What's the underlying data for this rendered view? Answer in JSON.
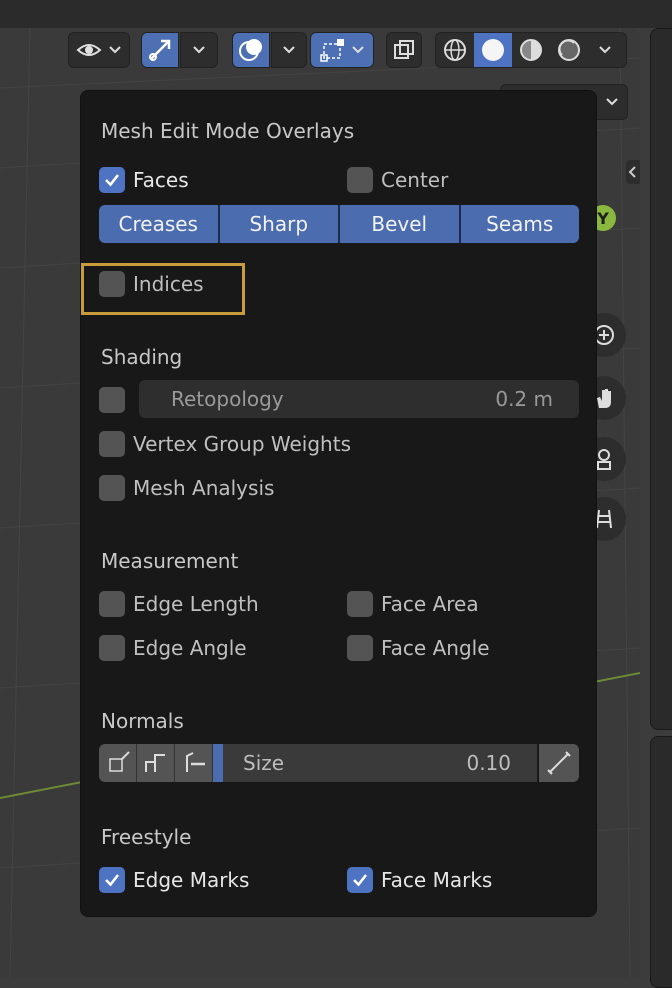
{
  "panel": {
    "title": "Mesh Edit Mode Overlays",
    "faces_label": "Faces",
    "faces_checked": true,
    "center_label": "Center",
    "center_checked": false,
    "edge_display_buttons": [
      "Creases",
      "Sharp",
      "Bevel",
      "Seams"
    ],
    "indices_label": "Indices",
    "indices_checked": false,
    "highlight_color": "#c89c3a"
  },
  "shading": {
    "heading": "Shading",
    "retopology_label": "Retopology",
    "retopology_value": "0.2 m",
    "vertex_group_weights_label": "Vertex Group Weights",
    "mesh_analysis_label": "Mesh Analysis"
  },
  "measurement": {
    "heading": "Measurement",
    "edge_length_label": "Edge Length",
    "face_area_label": "Face Area",
    "edge_angle_label": "Edge Angle",
    "face_angle_label": "Face Angle"
  },
  "normals": {
    "heading": "Normals",
    "size_label": "Size",
    "size_value": "0.10"
  },
  "freestyle": {
    "heading": "Freestyle",
    "edge_marks_label": "Edge Marks",
    "edge_marks_checked": true,
    "face_marks_label": "Face Marks",
    "face_marks_checked": true
  },
  "gizmo": {
    "y_label": "Y"
  },
  "colors": {
    "accent": "#4d73c2",
    "panel_bg": "#181818"
  }
}
